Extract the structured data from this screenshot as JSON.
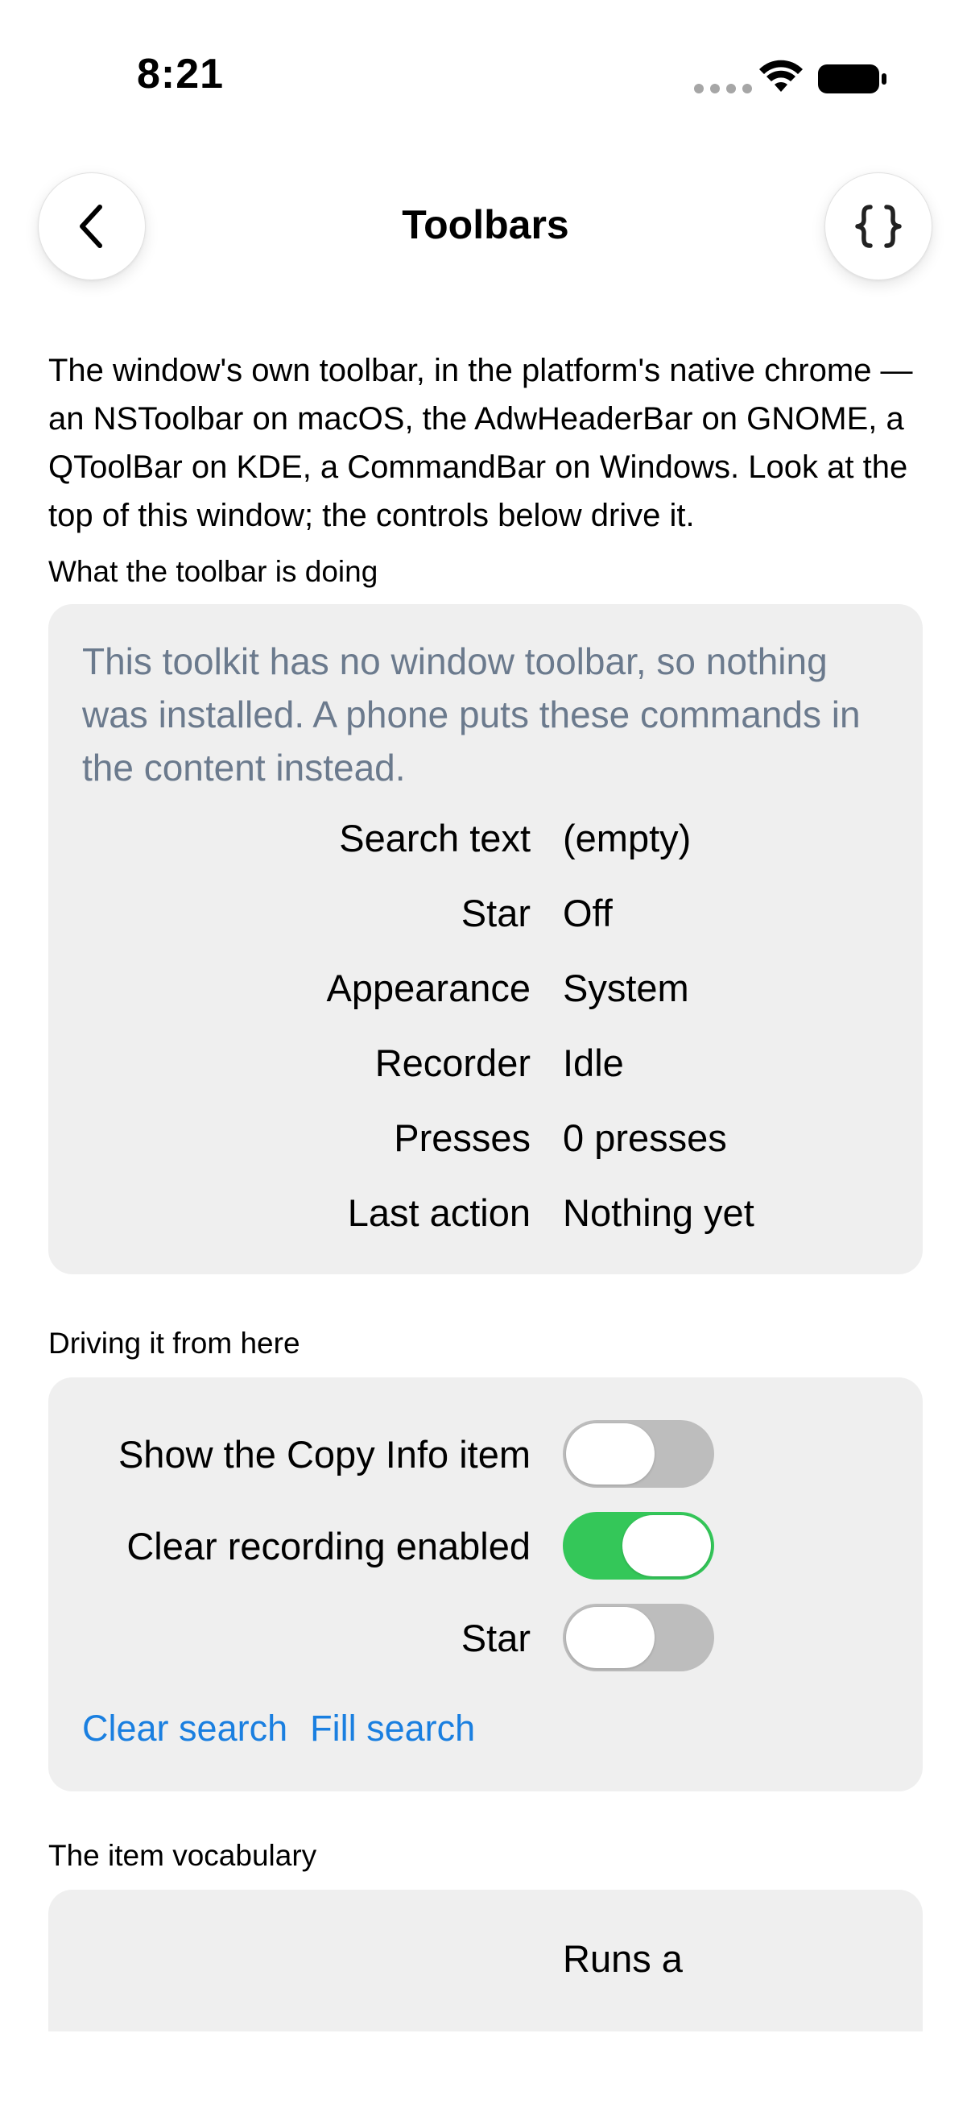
{
  "status_bar": {
    "time": "8:21"
  },
  "nav": {
    "title": "Toolbars",
    "back_icon": "chevron-left-icon",
    "code_icon": "braces-icon"
  },
  "intro": "The window's own toolbar, in the platform's native chrome — an NSToolbar on macOS, the AdwHeaderBar on GNOME, a QToolBar on KDE, a CommandBar on Windows. Look at the top of this window; the controls below drive it.",
  "status_section": {
    "label": "What the toolbar is doing",
    "message": "This toolkit has no window toolbar, so nothing was installed. A phone puts these commands in the content instead.",
    "rows": [
      {
        "key": "Search text",
        "value": "(empty)"
      },
      {
        "key": "Star",
        "value": "Off"
      },
      {
        "key": "Appearance",
        "value": "System"
      },
      {
        "key": "Recorder",
        "value": "Idle"
      },
      {
        "key": "Presses",
        "value": "0 presses"
      },
      {
        "key": "Last action",
        "value": "Nothing yet"
      }
    ]
  },
  "controls_section": {
    "label": "Driving it from here",
    "toggles": [
      {
        "label": "Show the Copy Info item",
        "on": false
      },
      {
        "label": "Clear recording enabled",
        "on": true
      },
      {
        "label": "Star",
        "on": false
      }
    ],
    "links": [
      "Clear search",
      "Fill search"
    ]
  },
  "vocab_section": {
    "label": "The item vocabulary",
    "first_value": "Runs a"
  },
  "colors": {
    "accent": "#1a7fe0",
    "switch_on": "#34c759",
    "switch_off": "#bdbdbd",
    "card_bg": "#efefef",
    "muted_text": "#6b7a8d"
  }
}
